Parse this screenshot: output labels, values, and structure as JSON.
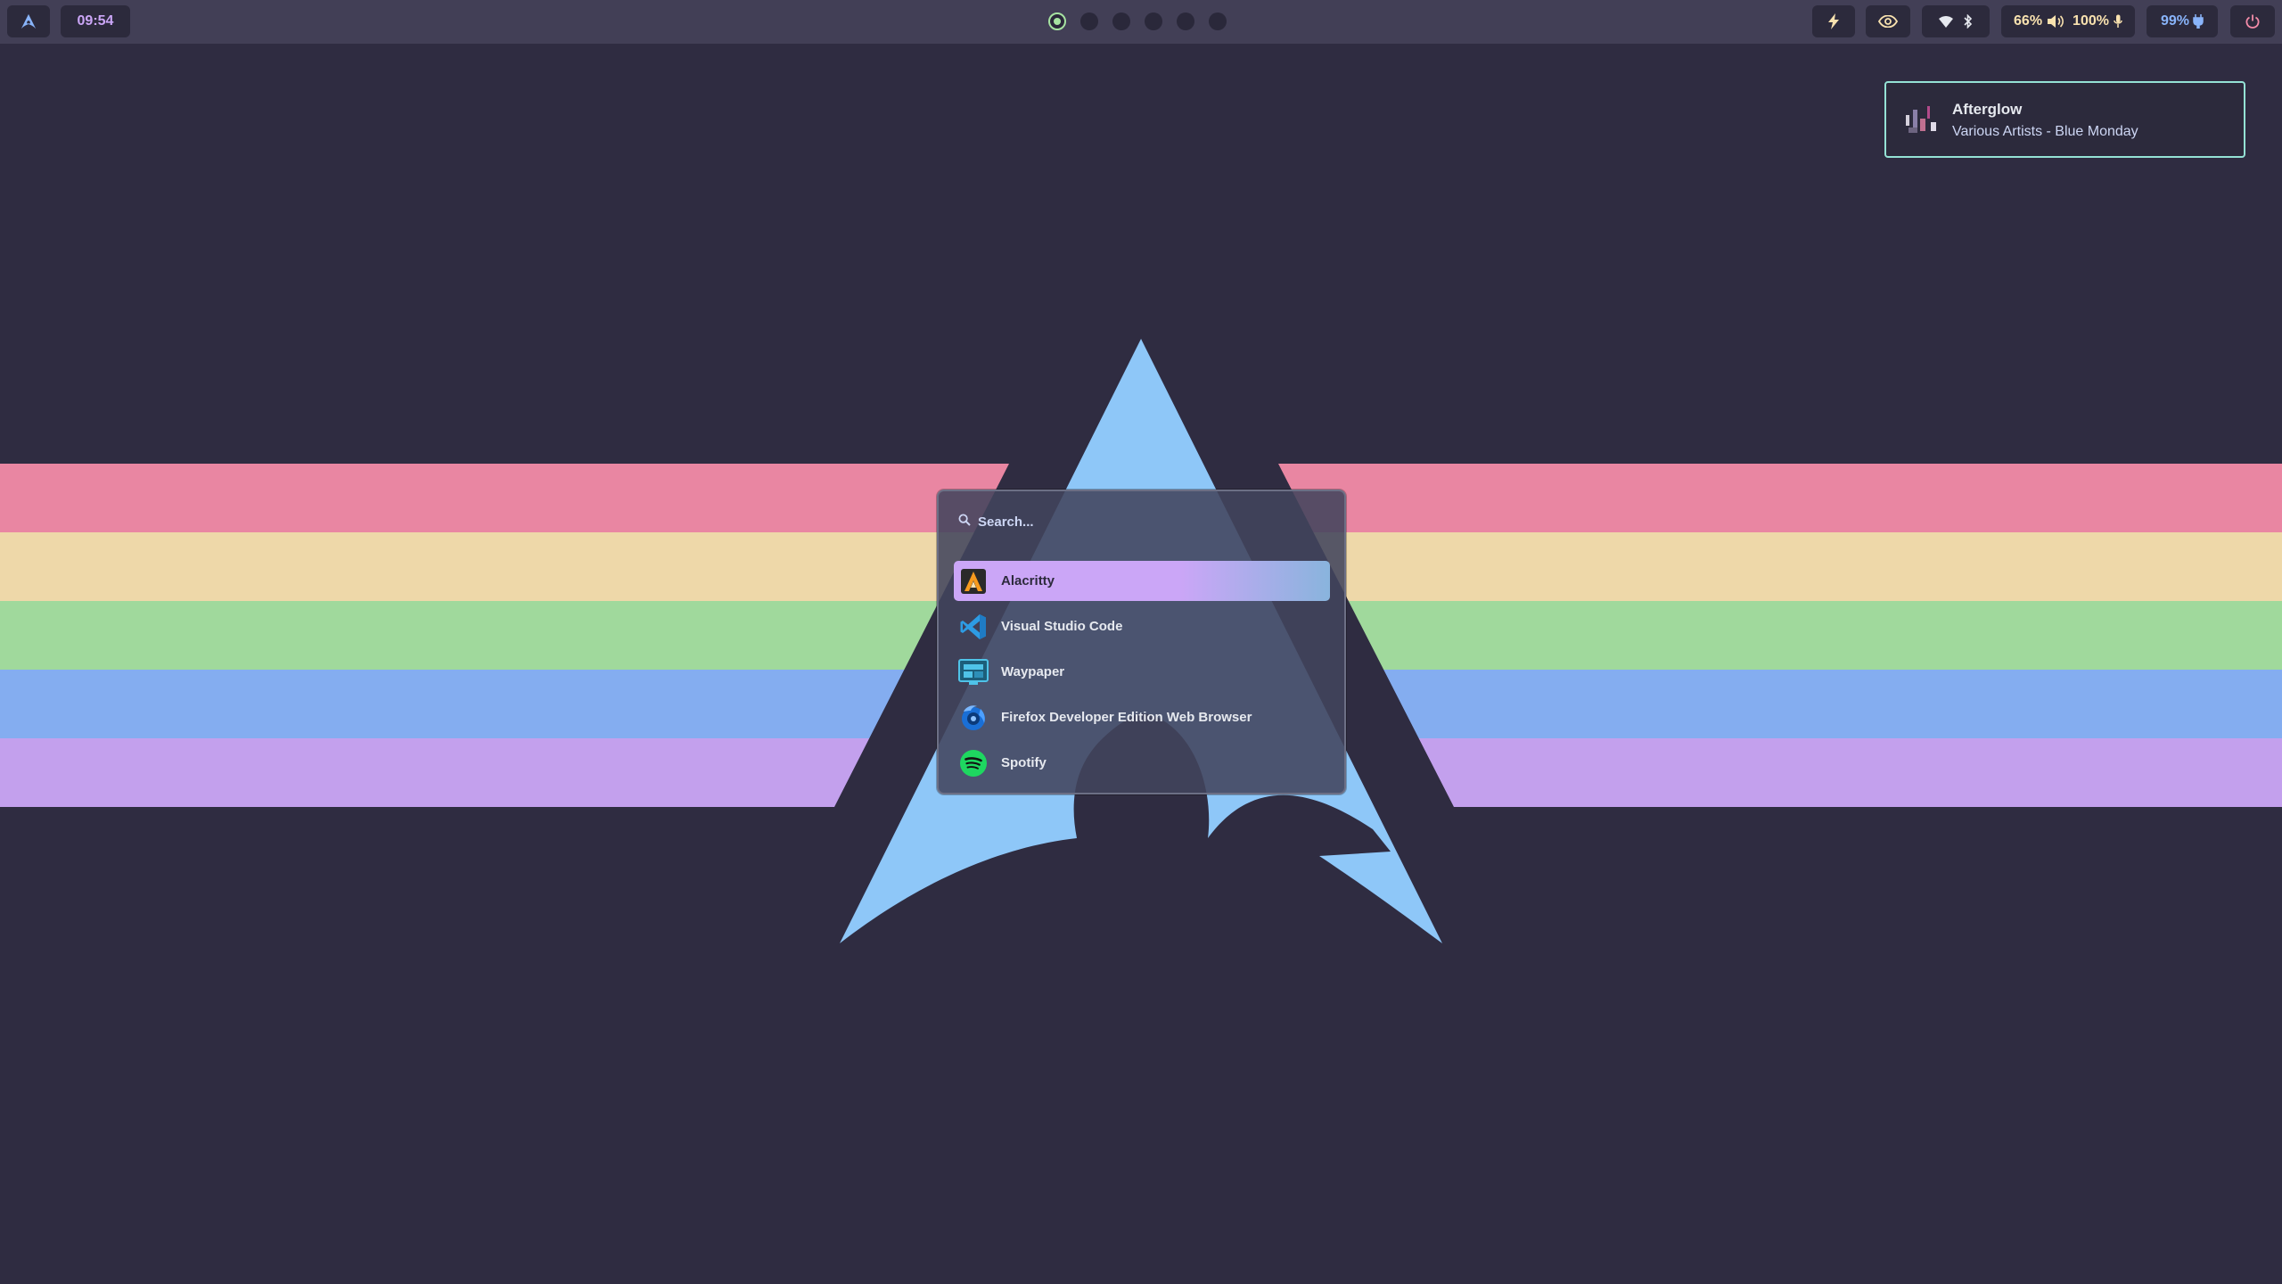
{
  "topbar": {
    "clock": "09:54",
    "workspaces": [
      {
        "name": "1",
        "active": true
      },
      {
        "name": "2",
        "active": false
      },
      {
        "name": "3",
        "active": false
      },
      {
        "name": "4",
        "active": false
      },
      {
        "name": "5",
        "active": false
      },
      {
        "name": "6",
        "active": false
      }
    ],
    "status": {
      "volume_text": "66%",
      "mic_text": "100%",
      "battery_text": "99%"
    },
    "icons": [
      "arch-logo-icon",
      "lightning-icon",
      "eye-icon",
      "wifi-icon",
      "bluetooth-icon",
      "speaker-icon",
      "microphone-icon",
      "charging-icon",
      "power-icon"
    ]
  },
  "notification": {
    "title": "Afterglow",
    "body": "Various Artists - Blue Monday"
  },
  "launcher": {
    "search_placeholder": "Search...",
    "entries": [
      {
        "label": "Alacritty",
        "icon": "alacritty-icon",
        "selected": true
      },
      {
        "label": "Visual Studio Code",
        "icon": "vscode-icon",
        "selected": false
      },
      {
        "label": "Waypaper",
        "icon": "waypaper-icon",
        "selected": false
      },
      {
        "label": "Firefox Developer Edition Web Browser",
        "icon": "firefox-dev-icon",
        "selected": false
      },
      {
        "label": "Spotify",
        "icon": "spotify-icon",
        "selected": false
      }
    ]
  },
  "colors": {
    "background": "#2f2c41",
    "bar": "#423f56",
    "pill": "#2c2a3c",
    "stripe_pink": "#f38ba8",
    "stripe_yellow": "#f9e2af",
    "stripe_green": "#a6e3a1",
    "stripe_blue": "#89b4fa",
    "stripe_purple": "#cba6f7",
    "arch_blue": "#89c4f7",
    "accent_teal": "#94e2d5"
  }
}
